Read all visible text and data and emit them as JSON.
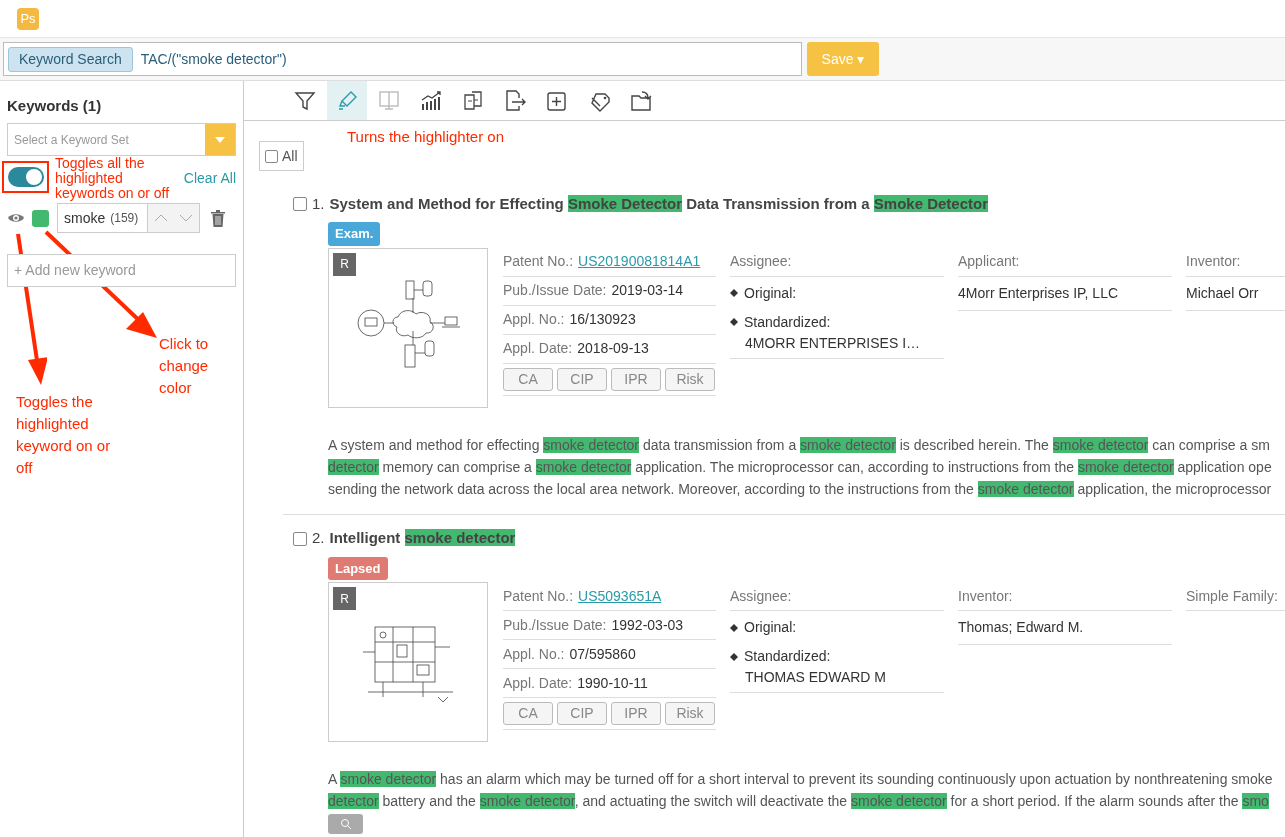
{
  "app": {
    "logo": "Ps"
  },
  "search": {
    "chip": "Keyword Search",
    "query": "TAC/(\"smoke detector\")",
    "save": "Save ▾"
  },
  "sidebar": {
    "title": "Keywords (1)",
    "keyword_set_placeholder": "Select a Keyword Set",
    "highlight_all_on": true,
    "clear_all": "Clear All",
    "keywords": [
      {
        "text": "smoke",
        "count": "(159)",
        "visible": true,
        "color": "#43b96f"
      }
    ],
    "add_placeholder": "+ Add new keyword"
  },
  "toolbar": [
    {
      "kind": "filter",
      "selected": false,
      "disabled": false
    },
    {
      "kind": "highlighter",
      "selected": true,
      "disabled": false
    },
    {
      "kind": "split",
      "selected": false,
      "disabled": true
    },
    {
      "kind": "chart",
      "selected": false,
      "disabled": false
    },
    {
      "kind": "compare",
      "selected": false,
      "disabled": false
    },
    {
      "kind": "export",
      "selected": false,
      "disabled": false
    },
    {
      "kind": "add",
      "selected": false,
      "disabled": false
    },
    {
      "kind": "tags",
      "selected": false,
      "disabled": false
    },
    {
      "kind": "move",
      "selected": false,
      "disabled": false
    }
  ],
  "select_all": {
    "label": "All",
    "checked": false
  },
  "patents": [
    {
      "number": "1.",
      "checked": false,
      "title": [
        {
          "text": "System and Method for Effecting ",
          "highlighted": false
        },
        {
          "text": "Smoke Detector",
          "highlighted": true
        },
        {
          "text": " Data Transmission from a ",
          "highlighted": false
        },
        {
          "text": "Smoke Detector",
          "highlighted": true
        }
      ],
      "status": {
        "label": "Exam.",
        "color": "#4aa8d8"
      },
      "drawing": {
        "kind": "network",
        "badge": "R"
      },
      "fields": [
        {
          "label": "Patent No.:",
          "value": "US20190081814A1",
          "kind": "link"
        },
        {
          "label": "Pub./Issue Date:",
          "value": "2019-03-14",
          "kind": "text"
        },
        {
          "label": "Appl. No.:",
          "value": "16/130923",
          "kind": "text"
        },
        {
          "label": "Appl. Date:",
          "value": "2018-09-13",
          "kind": "text"
        }
      ],
      "tags": [
        "CA",
        "CIP",
        "IPR",
        "Risk"
      ],
      "columns": [
        {
          "heading": "Assignee:",
          "rows": [
            {
              "kind": "bullet",
              "text": "Original:"
            },
            {
              "kind": "bullet",
              "text": "Standardized:",
              "detail": "4MORR ENTERPRISES I…"
            }
          ]
        },
        {
          "heading": "Applicant:",
          "rows": [
            {
              "kind": "plain",
              "text": "4Morr Enterprises IP, LLC"
            }
          ]
        },
        {
          "heading": "Inventor:",
          "rows": [
            {
              "kind": "plain",
              "text": "Michael Orr"
            }
          ]
        }
      ],
      "abstract": [
        [
          {
            "text": "A system and method for effecting ",
            "highlighted": false
          },
          {
            "text": "smoke detector",
            "highlighted": true
          },
          {
            "text": " data transmission from a ",
            "highlighted": false
          },
          {
            "text": "smoke detector",
            "highlighted": true
          },
          {
            "text": " is described herein. The ",
            "highlighted": false
          },
          {
            "text": "smoke detector",
            "highlighted": true
          },
          {
            "text": " can comprise a sm",
            "highlighted": false
          }
        ],
        [
          {
            "text": "detector",
            "highlighted": true
          },
          {
            "text": " memory can comprise a ",
            "highlighted": false
          },
          {
            "text": "smoke detector",
            "highlighted": true
          },
          {
            "text": " application. The microprocessor can, according to instructions from the ",
            "highlighted": false
          },
          {
            "text": "smoke detector",
            "highlighted": true
          },
          {
            "text": " application ope",
            "highlighted": false
          }
        ],
        [
          {
            "text": "sending the network data across the local area network. Moreover, according to the instructions from the ",
            "highlighted": false
          },
          {
            "text": "smoke detector",
            "highlighted": true
          },
          {
            "text": " application, the microprocessor",
            "highlighted": false
          }
        ]
      ]
    },
    {
      "number": "2.",
      "checked": false,
      "title": [
        {
          "text": "Intelligent ",
          "highlighted": false
        },
        {
          "text": "smoke detector",
          "highlighted": true
        }
      ],
      "status": {
        "label": "Lapsed",
        "color": "#e07b73"
      },
      "drawing": {
        "kind": "circuit",
        "badge": "R"
      },
      "fields": [
        {
          "label": "Patent No.:",
          "value": "US5093651A",
          "kind": "link"
        },
        {
          "label": "Pub./Issue Date:",
          "value": "1992-03-03",
          "kind": "text"
        },
        {
          "label": "Appl. No.:",
          "value": "07/595860",
          "kind": "text"
        },
        {
          "label": "Appl. Date:",
          "value": "1990-10-11",
          "kind": "text"
        }
      ],
      "tags": [
        "CA",
        "CIP",
        "IPR",
        "Risk"
      ],
      "columns": [
        {
          "heading": "Assignee:",
          "rows": [
            {
              "kind": "bullet",
              "text": "Original:"
            },
            {
              "kind": "bullet",
              "text": "Standardized:",
              "detail": "THOMAS EDWARD M"
            }
          ]
        },
        {
          "heading": "Inventor:",
          "rows": [
            {
              "kind": "plain",
              "text": "Thomas; Edward M."
            }
          ]
        },
        {
          "heading": "Simple Family:"
        }
      ],
      "abstract": [
        [
          {
            "text": "A ",
            "highlighted": false
          },
          {
            "text": "smoke detector",
            "highlighted": true
          },
          {
            "text": " has an alarm which may be turned off for a short interval to prevent its sounding continuously upon actuation by nonthreatening smoke",
            "highlighted": false
          }
        ],
        [
          {
            "text": "detector",
            "highlighted": true
          },
          {
            "text": " battery and the ",
            "highlighted": false
          },
          {
            "text": "smoke detector",
            "highlighted": true
          },
          {
            "text": ", and actuating the switch will deactivate the ",
            "highlighted": false
          },
          {
            "text": "smoke detector",
            "highlighted": true
          },
          {
            "text": " for a short period. If the alarm sounds after the ",
            "highlighted": false
          },
          {
            "text": "smo",
            "highlighted": true
          }
        ]
      ]
    }
  ],
  "annotations": [
    {
      "kind": "toggle_all",
      "text": "Toggles all the highlighted keywords on or off"
    },
    {
      "kind": "highlighter",
      "text": "Turns the highlighter on"
    },
    {
      "kind": "color",
      "text": "Click to change color"
    },
    {
      "kind": "eye",
      "text": "Toggles the highlighted keyword on or off"
    }
  ]
}
